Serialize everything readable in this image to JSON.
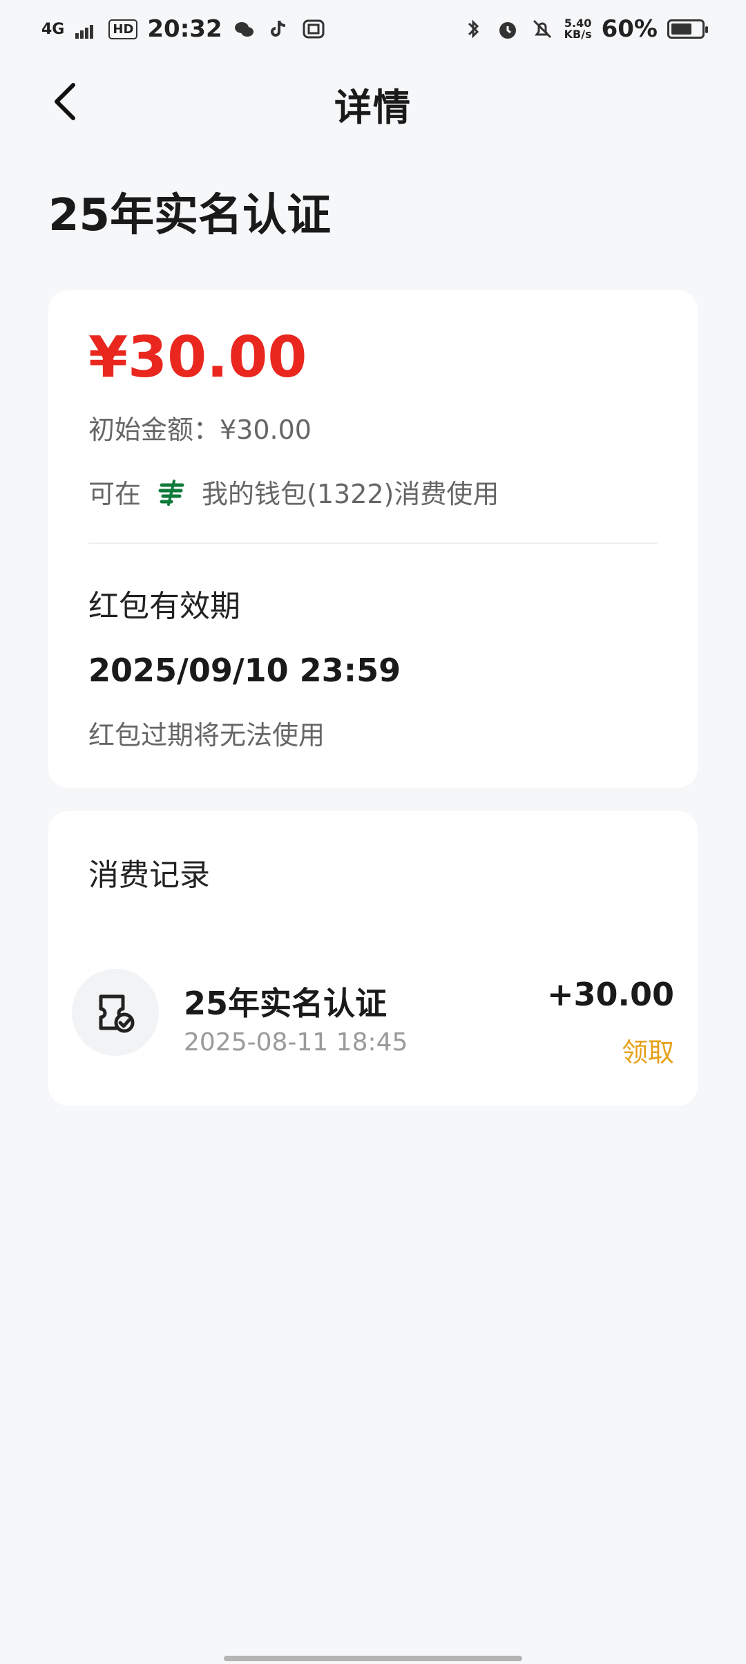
{
  "status": {
    "network": "4G",
    "hd": "HD",
    "time": "20:32",
    "speed_value": "5.40",
    "speed_unit": "KB/s",
    "battery_percent": "60%"
  },
  "header": {
    "title": "详情"
  },
  "main": {
    "title": "25年实名认证"
  },
  "card": {
    "amount": "¥30.00",
    "initial_label": "初始金额：¥30.00",
    "usage_prefix": "可在",
    "usage_text": "我的钱包(1322)消费使用",
    "valid_title": "红包有效期",
    "valid_date": "2025/09/10 23:59",
    "valid_note": "红包过期将无法使用"
  },
  "records": {
    "title": "消费记录",
    "items": [
      {
        "name": "25年实名认证",
        "time": "2025-08-11 18:45",
        "amount": "+30.00",
        "status": "领取"
      }
    ]
  },
  "colors": {
    "accent_red": "#E9271E",
    "accent_gold": "#E6A11C",
    "wallet_green": "#0F7A3A"
  },
  "icons": {
    "back": "chevron-left-icon",
    "wallet": "postal-bank-icon",
    "record": "voucher-check-icon"
  }
}
